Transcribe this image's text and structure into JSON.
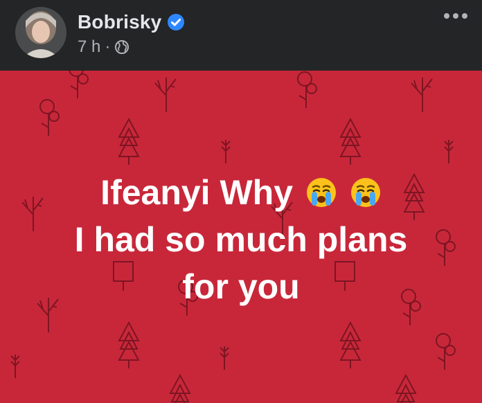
{
  "post": {
    "author_name": "Bobrisky",
    "time": "7 h",
    "separator": "·",
    "text_lines": [
      "Ifeanyi Why",
      "I had so much plans",
      "for you"
    ],
    "emoji": "crying-face-emoji",
    "emoji_count": 2
  },
  "icons": {
    "verified": "verified-badge-icon",
    "privacy": "globe-icon",
    "more": "more-options-icon"
  },
  "colors": {
    "header_bg": "#242526",
    "post_bg": "#c8273a",
    "verified": "#2d88ff",
    "text": "#ffffff"
  }
}
